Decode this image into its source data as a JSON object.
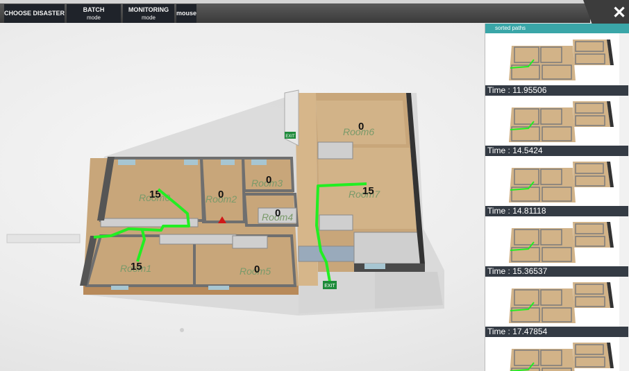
{
  "toolbar": {
    "choose_disaster": "CHOOSE DISASTER",
    "batch": {
      "title": "BATCH",
      "sub": "mode"
    },
    "monitoring": {
      "title": "MONITORING",
      "sub": "mode"
    },
    "mouse": "mouse",
    "close_icon": "close-icon"
  },
  "map": {
    "rooms": [
      {
        "name": "Room0",
        "count": "15"
      },
      {
        "name": "Room1",
        "count": "15"
      },
      {
        "name": "Room2",
        "count": "0"
      },
      {
        "name": "Room3",
        "count": "0"
      },
      {
        "name": "Room4",
        "count": "0"
      },
      {
        "name": "Room5",
        "count": "0"
      },
      {
        "name": "Room6",
        "count": "0"
      },
      {
        "name": "Room7",
        "count": "15"
      }
    ],
    "exit_label": "EXIT",
    "path_color": "#22ee22",
    "floor_color": "#c8a67a"
  },
  "panel": {
    "title": "sorted paths",
    "paths": [
      {
        "time": "Time : 11.95506"
      },
      {
        "time": "Time : 14.5424"
      },
      {
        "time": "Time : 14.81118"
      },
      {
        "time": "Time : 15.36537"
      },
      {
        "time": "Time : 17.47854"
      }
    ]
  }
}
